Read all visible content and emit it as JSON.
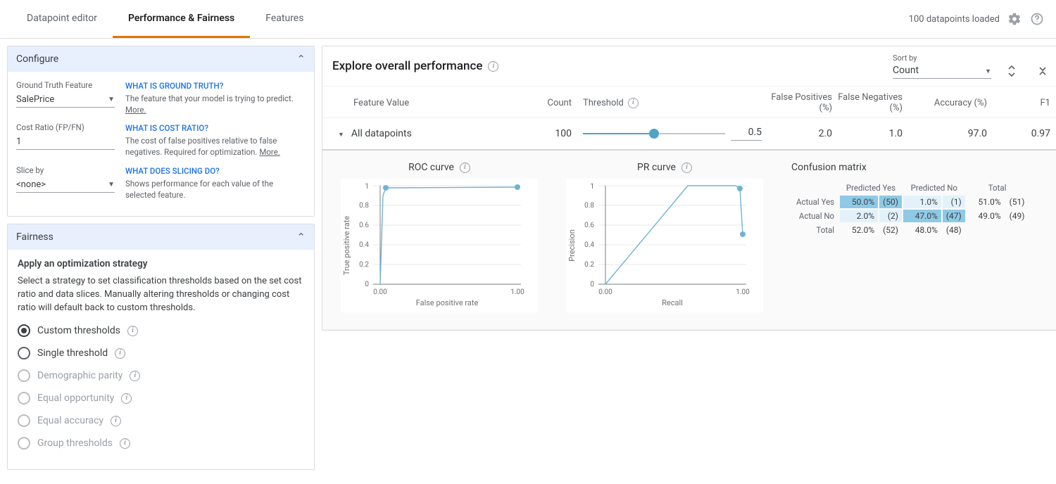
{
  "header": {
    "tabs": [
      "Datapoint editor",
      "Performance & Fairness",
      "Features"
    ],
    "active_tab_index": 1,
    "datapoints_loaded": "100 datapoints loaded"
  },
  "configure": {
    "title": "Configure",
    "ground_truth_label": "Ground Truth Feature",
    "ground_truth_value": "SalePrice",
    "ground_truth_q": "WHAT IS GROUND TRUTH?",
    "ground_truth_help": "The feature that your model is trying to predict.",
    "cost_ratio_label": "Cost Ratio (FP/FN)",
    "cost_ratio_value": "1",
    "cost_ratio_q": "WHAT IS COST RATIO?",
    "cost_ratio_help": "The cost of false positives relative to false negatives. Required for optimization.",
    "slice_label": "Slice by",
    "slice_value": "<none>",
    "slice_q": "WHAT DOES SLICING DO?",
    "slice_help": "Shows performance for each value of the selected feature.",
    "more": "More."
  },
  "fairness": {
    "title": "Fairness",
    "body_title": "Apply an optimization strategy",
    "body_desc": "Select a strategy to set classification thresholds based on the set cost ratio and data slices. Manually altering thresholds or changing cost ratio will default back to custom thresholds.",
    "options": [
      {
        "label": "Custom thresholds",
        "selected": true,
        "enabled": true
      },
      {
        "label": "Single threshold",
        "selected": false,
        "enabled": true
      },
      {
        "label": "Demographic parity",
        "selected": false,
        "enabled": false
      },
      {
        "label": "Equal opportunity",
        "selected": false,
        "enabled": false
      },
      {
        "label": "Equal accuracy",
        "selected": false,
        "enabled": false
      },
      {
        "label": "Group thresholds",
        "selected": false,
        "enabled": false
      }
    ]
  },
  "main": {
    "title": "Explore overall performance",
    "sort_label": "Sort by",
    "sort_value": "Count",
    "columns": {
      "feature_value": "Feature Value",
      "count": "Count",
      "threshold": "Threshold",
      "fp": "False Positives (%)",
      "fn": "False Negatives (%)",
      "acc": "Accuracy (%)",
      "f1": "F1"
    },
    "row": {
      "feature_value": "All datapoints",
      "count": "100",
      "threshold": "0.5",
      "fp": "2.0",
      "fn": "1.0",
      "acc": "97.0",
      "f1": "0.97"
    },
    "roc_title": "ROC curve",
    "pr_title": "PR curve",
    "cm_title": "Confusion matrix",
    "cm": {
      "pred_yes": "Predicted Yes",
      "pred_no": "Predicted No",
      "total": "Total",
      "actual_yes": "Actual Yes",
      "actual_no": "Actual No",
      "ay_py_pct": "50.0%",
      "ay_py_n": "(50)",
      "ay_pn_pct": "1.0%",
      "ay_pn_n": "(1)",
      "ay_tot_pct": "51.0%",
      "ay_tot_n": "(51)",
      "an_py_pct": "2.0%",
      "an_py_n": "(2)",
      "an_pn_pct": "47.0%",
      "an_pn_n": "(47)",
      "an_tot_pct": "49.0%",
      "an_tot_n": "(49)",
      "t_py_pct": "52.0%",
      "t_py_n": "(52)",
      "t_pn_pct": "48.0%",
      "t_pn_n": "(48)"
    }
  },
  "chart_data": [
    {
      "type": "line",
      "title": "ROC curve",
      "xlabel": "False positive rate",
      "ylabel": "True positive rate",
      "xlim": [
        0,
        1
      ],
      "ylim": [
        0,
        1
      ],
      "x_ticks": [
        0.0,
        1.0
      ],
      "y_ticks": [
        0,
        0.2,
        0.4,
        0.6,
        0.8,
        1
      ],
      "series": [
        {
          "name": "ROC",
          "x": [
            0.0,
            0.02,
            0.04,
            1.0
          ],
          "y": [
            0.0,
            0.9,
            0.98,
            0.99
          ]
        }
      ],
      "markers": [
        {
          "x": 0.04,
          "y": 0.98
        },
        {
          "x": 1.0,
          "y": 0.99
        }
      ]
    },
    {
      "type": "line",
      "title": "PR curve",
      "xlabel": "Recall",
      "ylabel": "Precision",
      "xlim": [
        0,
        1
      ],
      "ylim": [
        0,
        1
      ],
      "x_ticks": [
        0.0,
        1.0
      ],
      "y_ticks": [
        0,
        0.2,
        0.4,
        0.6,
        0.8,
        1
      ],
      "series": [
        {
          "name": "PR",
          "x": [
            0.0,
            0.6,
            0.95,
            0.98,
            1.0
          ],
          "y": [
            0.0,
            1.0,
            1.0,
            0.97,
            0.51
          ]
        }
      ],
      "markers": [
        {
          "x": 0.98,
          "y": 0.97
        },
        {
          "x": 1.0,
          "y": 0.51
        }
      ]
    }
  ]
}
